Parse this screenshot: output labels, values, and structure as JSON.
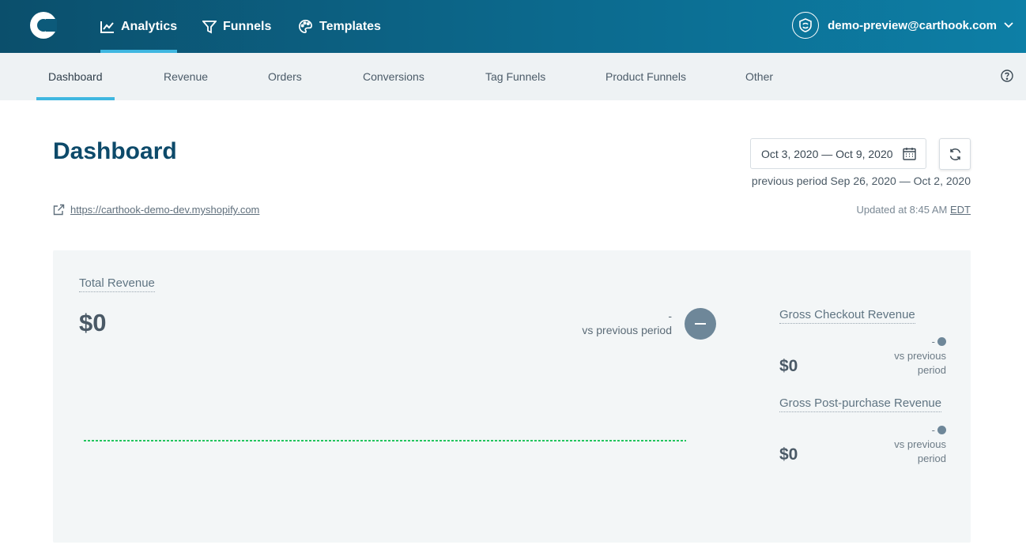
{
  "header": {
    "nav": [
      {
        "label": "Analytics",
        "icon": "line-chart-icon",
        "active": true
      },
      {
        "label": "Funnels",
        "icon": "funnel-icon"
      },
      {
        "label": "Templates",
        "icon": "palette-icon"
      }
    ],
    "user_email": "demo-preview@carthook.com"
  },
  "subnav": {
    "tabs": [
      "Dashboard",
      "Revenue",
      "Orders",
      "Conversions",
      "Tag Funnels",
      "Product Funnels",
      "Other"
    ],
    "active": "Dashboard"
  },
  "page": {
    "title": "Dashboard",
    "date_range": "Oct 3, 2020 — Oct 9, 2020",
    "previous_period": "previous period Sep 26, 2020 — Oct 2, 2020",
    "store_url": "https://carthook-demo-dev.myshopify.com",
    "updated_prefix": "Updated at 8:45 AM",
    "timezone": "EDT"
  },
  "card": {
    "total_label": "Total Revenue",
    "total_value": "$0",
    "total_change": "-",
    "vs_label": "vs previous period",
    "side": [
      {
        "label": "Gross Checkout Revenue",
        "value": "$0",
        "change": "-",
        "vs_line1": "vs previous",
        "vs_line2": "period"
      },
      {
        "label": "Gross Post-purchase Revenue",
        "value": "$0",
        "change": "-",
        "vs_line1": "vs previous",
        "vs_line2": "period"
      }
    ]
  },
  "chart_data": {
    "type": "line",
    "series": [
      {
        "values": [
          0,
          0,
          0,
          0,
          0,
          0,
          0
        ]
      }
    ],
    "colors": {
      "line": "#22c55e"
    }
  },
  "colors": {
    "accent": "#3fb7e0",
    "header": "#0c6a8e",
    "title": "#0d4a6a"
  }
}
